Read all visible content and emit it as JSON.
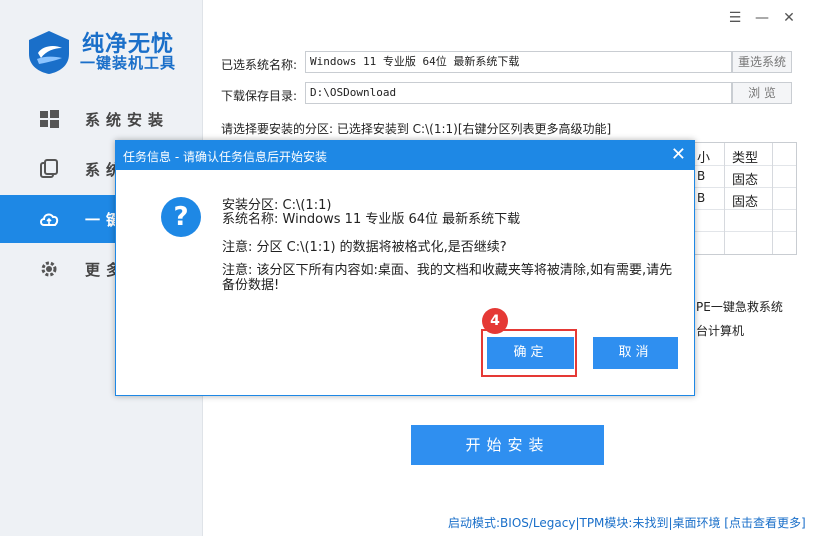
{
  "brand": {
    "name": "纯净无忧",
    "subtitle": "一键装机工具",
    "accent_color": "#1e88e5"
  },
  "sidebar": {
    "items": [
      {
        "label": "系统安装",
        "icon": "windows-icon",
        "active": false
      },
      {
        "label": "系统",
        "icon": "copy-icon",
        "active": false
      },
      {
        "label": "一键",
        "icon": "cloud-upload-icon",
        "active": true
      },
      {
        "label": "更多",
        "icon": "gear-icon",
        "active": false
      }
    ]
  },
  "window_controls": {
    "menu": "☰",
    "minimize": "—",
    "close": "✕"
  },
  "form": {
    "system_name_label": "已选系统名称:",
    "system_name_value": "Windows 11 专业版  64位  最新系统下载",
    "reselect_button": "重选系统",
    "save_dir_label": "下载保存目录:",
    "save_dir_value": "D:\\OSDownload",
    "browse_button": "浏 览",
    "partition_prompt": "请选择要安装的分区: 已选择安装到 C:\\(1:1)[右键分区列表更多高级功能]"
  },
  "partition_table": {
    "headers": [
      "小",
      "类型"
    ],
    "rows": [
      {
        "size_tail": "B",
        "type": "固态"
      },
      {
        "size_tail": "B",
        "type": "固态"
      }
    ]
  },
  "side_text": {
    "pe_option": "PE一键急救系统",
    "computer_option": "台计算机"
  },
  "start_button": "开始安装",
  "status_bar": "启动模式:BIOS/Legacy|TPM模块:未找到|桌面环境 [点击查看更多]",
  "dialog": {
    "title": "任务信息 - 请确认任务信息后开始安装",
    "close": "✕",
    "icon": "question-icon",
    "partition_line": "安装分区: C:\\(1:1)",
    "system_line": "系统名称: Windows 11 专业版  64位  最新系统下载",
    "notice_line": "注意: 分区 C:\\(1:1) 的数据将被格式化,是否继续?",
    "warning_text": "注意: 该分区下所有内容如:桌面、我的文档和收藏夹等将被清除,如有需要,请先备份数据!",
    "confirm_button": "确定",
    "cancel_button": "取消",
    "step_badge": "4",
    "highlight_color": "#e53935"
  }
}
